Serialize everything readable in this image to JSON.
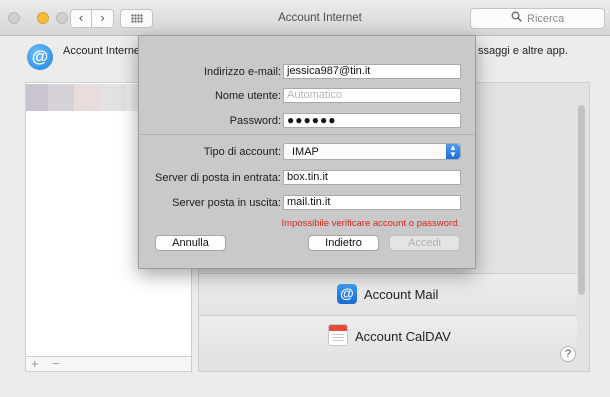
{
  "window": {
    "title": "Account Internet"
  },
  "toolbar": {
    "search_placeholder": "Ricerca",
    "back_glyph": "‹",
    "forward_glyph": "›"
  },
  "header": {
    "title_left": "Account Interne",
    "text_right": "ssaggi e altre app.",
    "icon_glyph": "@"
  },
  "accounts": [
    {
      "label": "Account Mail",
      "icon": "mail-icon",
      "glyph": "@"
    },
    {
      "label": "Account CalDAV",
      "icon": "calendar-icon"
    }
  ],
  "list_footer": {
    "add": "+",
    "remove": "−"
  },
  "help": {
    "glyph": "?"
  },
  "sheet": {
    "email_label": "Indirizzo e-mail:",
    "email_value": "jessica987@tin.it",
    "username_label": "Nome utente:",
    "username_placeholder": "Automatico",
    "password_label": "Password:",
    "password_value": "●●●●●●",
    "account_type_label": "Tipo di account:",
    "account_type_value": "IMAP",
    "incoming_label": "Server di posta in entrata:",
    "incoming_value": "box.tin.it",
    "outgoing_label": "Server posta in uscita:",
    "outgoing_value": "mail.tin.it",
    "error_message": "Impossibile verificare account o password.",
    "cancel_label": "Annulla",
    "back_label": "Indietro",
    "signin_label": "Accedi"
  },
  "colors": {
    "accent": "#1f7fdc",
    "error": "#d8251f",
    "sheet_bg": "#c9c9c9"
  }
}
